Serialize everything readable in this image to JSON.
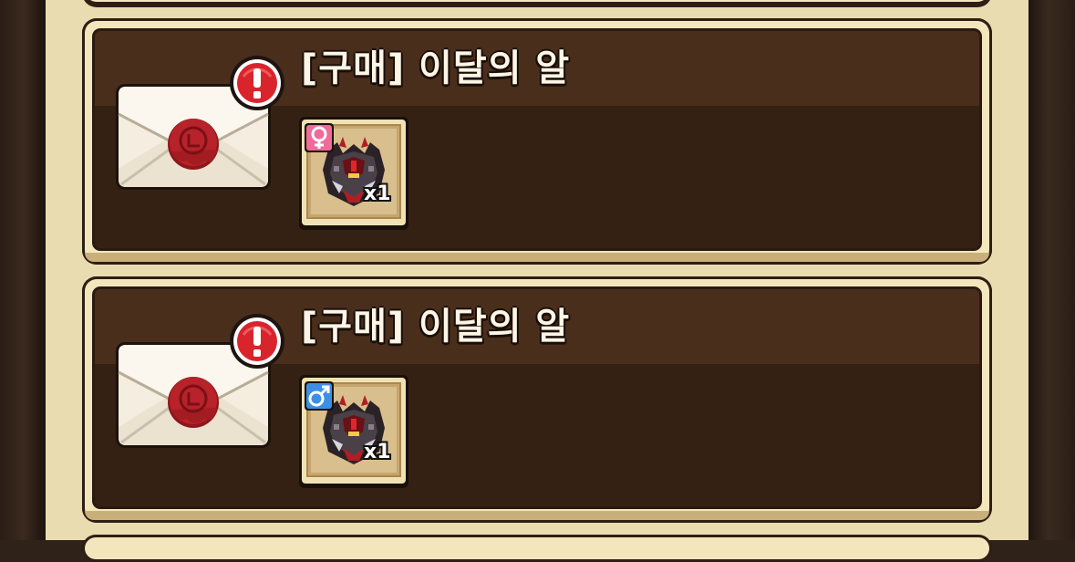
{
  "mail_list": {
    "items": [
      {
        "title": "[구매] 이달의 알",
        "has_alert": true,
        "reward": {
          "icon": "dark-dragon-egg-icon",
          "quantity": "x1",
          "gender": "female",
          "gender_color": "#f06a9a"
        }
      },
      {
        "title": "[구매] 이달의 알",
        "has_alert": true,
        "reward": {
          "icon": "dark-dragon-egg-icon",
          "quantity": "x1",
          "gender": "male",
          "gender_color": "#3d8fe6"
        }
      }
    ]
  },
  "colors": {
    "panel_bg": "#e9dcb0",
    "card_header": "#4a2e1c",
    "card_body": "#352113",
    "alert_red": "#d9242c",
    "seal_red": "#b01e23"
  }
}
